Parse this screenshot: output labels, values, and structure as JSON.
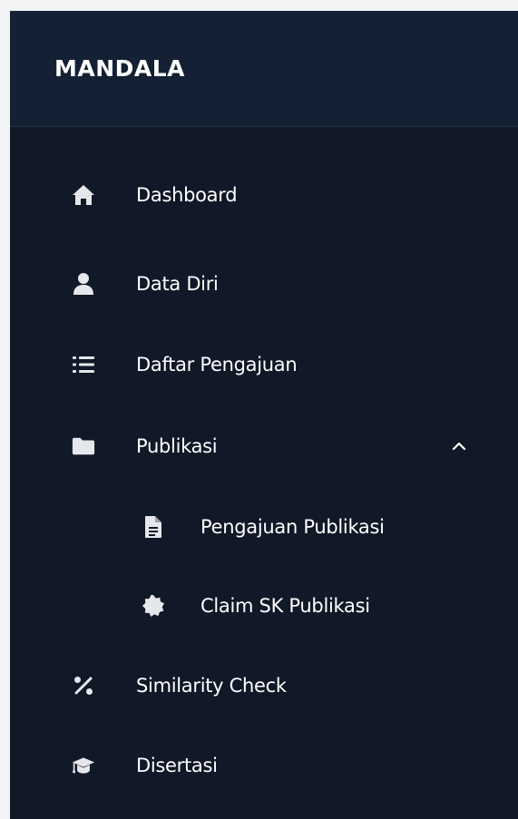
{
  "brand": {
    "title": "MANDALA"
  },
  "menu": {
    "items": [
      {
        "label": "Dashboard",
        "icon": "home-icon"
      },
      {
        "label": "Data Diri",
        "icon": "user-icon"
      },
      {
        "label": "Daftar Pengajuan",
        "icon": "list-icon"
      },
      {
        "label": "Publikasi",
        "icon": "folder-icon",
        "expanded": true,
        "chevron": "chevron-up-icon"
      },
      {
        "label": "Pengajuan Publikasi",
        "icon": "file-icon",
        "submenu": true
      },
      {
        "label": "Claim SK Publikasi",
        "icon": "certificate-icon",
        "submenu": true
      },
      {
        "label": "Similarity Check",
        "icon": "percent-icon"
      },
      {
        "label": "Disertasi",
        "icon": "graduation-cap-icon"
      }
    ]
  },
  "colors": {
    "sidebar_bg": "#111827",
    "header_bg": "#142034",
    "text": "#ffffff",
    "icon": "#e5e7eb"
  }
}
